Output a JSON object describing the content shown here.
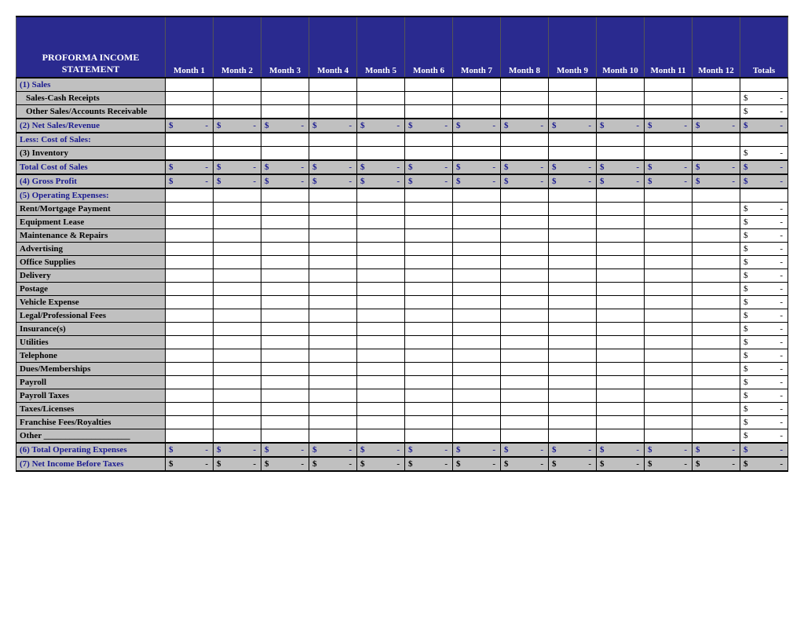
{
  "title": "PROFORMA INCOME STATEMENT",
  "months": [
    "Month 1",
    "Month 2",
    "Month 3",
    "Month 4",
    "Month 5",
    "Month 6",
    "Month 7",
    "Month 8",
    "Month 9",
    "Month 10",
    "Month 11",
    "Month 12"
  ],
  "totals_label": "Totals",
  "currency": "$",
  "dash": "-",
  "rows": [
    {
      "id": "sales",
      "label": "(1) Sales",
      "type": "section",
      "months": false,
      "total": false
    },
    {
      "id": "cash_receipts",
      "label": "Sales-Cash Receipts",
      "type": "sub",
      "months": false,
      "total": "dash"
    },
    {
      "id": "other_sales",
      "label": "Other Sales/Accounts Receivable",
      "type": "sub",
      "months": false,
      "total": "dash",
      "border": "bottom-heavy"
    },
    {
      "id": "net_sales",
      "label": "(2) Net Sales/Revenue",
      "type": "subtotal",
      "months": "dash",
      "total": "dash",
      "border": "heavy"
    },
    {
      "id": "less_cogs",
      "label": "Less: Cost of Sales:",
      "type": "section",
      "months": false,
      "total": false
    },
    {
      "id": "inventory",
      "label": "(3) Inventory",
      "type": "plain",
      "months": false,
      "total": "dash",
      "border": "bottom-heavy"
    },
    {
      "id": "total_cogs",
      "label": "Total Cost of Sales",
      "type": "subtotal",
      "months": "dash",
      "total": "dash",
      "border": "heavy"
    },
    {
      "id": "gross_profit",
      "label": "(4) Gross Profit",
      "type": "subtotal",
      "months": "dash",
      "total": "dash",
      "border": "heavy"
    },
    {
      "id": "opex_hdr",
      "label": "(5) Operating Expenses:",
      "type": "section",
      "months": false,
      "total": false
    },
    {
      "id": "rent",
      "label": "Rent/Mortgage Payment",
      "type": "plain",
      "months": false,
      "total": "dash"
    },
    {
      "id": "equip_lease",
      "label": "Equipment Lease",
      "type": "plain",
      "months": false,
      "total": "dash"
    },
    {
      "id": "maint",
      "label": "Maintenance & Repairs",
      "type": "plain",
      "months": false,
      "total": "dash"
    },
    {
      "id": "advertising",
      "label": "Advertising",
      "type": "plain",
      "months": false,
      "total": "dash"
    },
    {
      "id": "office",
      "label": "Office Supplies",
      "type": "plain",
      "months": false,
      "total": "dash"
    },
    {
      "id": "delivery",
      "label": "Delivery",
      "type": "plain",
      "months": false,
      "total": "dash"
    },
    {
      "id": "postage",
      "label": "Postage",
      "type": "plain",
      "months": false,
      "total": "dash"
    },
    {
      "id": "vehicle",
      "label": "Vehicle Expense",
      "type": "plain",
      "months": false,
      "total": "dash"
    },
    {
      "id": "legal",
      "label": "Legal/Professional Fees",
      "type": "plain",
      "months": false,
      "total": "dash"
    },
    {
      "id": "insurance",
      "label": "Insurance(s)",
      "type": "plain",
      "months": false,
      "total": "dash"
    },
    {
      "id": "utilities",
      "label": "Utilities",
      "type": "plain",
      "months": false,
      "total": "dash"
    },
    {
      "id": "telephone",
      "label": "Telephone",
      "type": "plain",
      "months": false,
      "total": "dash"
    },
    {
      "id": "dues",
      "label": "Dues/Memberships",
      "type": "plain",
      "months": false,
      "total": "dash"
    },
    {
      "id": "payroll",
      "label": "Payroll",
      "type": "plain",
      "months": false,
      "total": "dash"
    },
    {
      "id": "payroll_tax",
      "label": "Payroll Taxes",
      "type": "plain",
      "months": false,
      "total": "dash"
    },
    {
      "id": "taxes_lic",
      "label": "Taxes/Licenses",
      "type": "plain",
      "months": false,
      "total": "dash"
    },
    {
      "id": "franchise",
      "label": "Franchise Fees/Royalties",
      "type": "plain",
      "months": false,
      "total": "dash"
    },
    {
      "id": "other",
      "label": "Other ____________________",
      "type": "plain",
      "months": false,
      "total": "dash",
      "border": "bottom-heavy"
    },
    {
      "id": "total_opex",
      "label": "(6)  Total Operating Expenses",
      "type": "subtotal",
      "months": "dash",
      "total": "dash",
      "border": "heavy"
    },
    {
      "id": "net_income",
      "label": "(7) Net Income Before Taxes",
      "type": "grand",
      "months": "dash",
      "total": "dash",
      "border": "heavy"
    }
  ]
}
